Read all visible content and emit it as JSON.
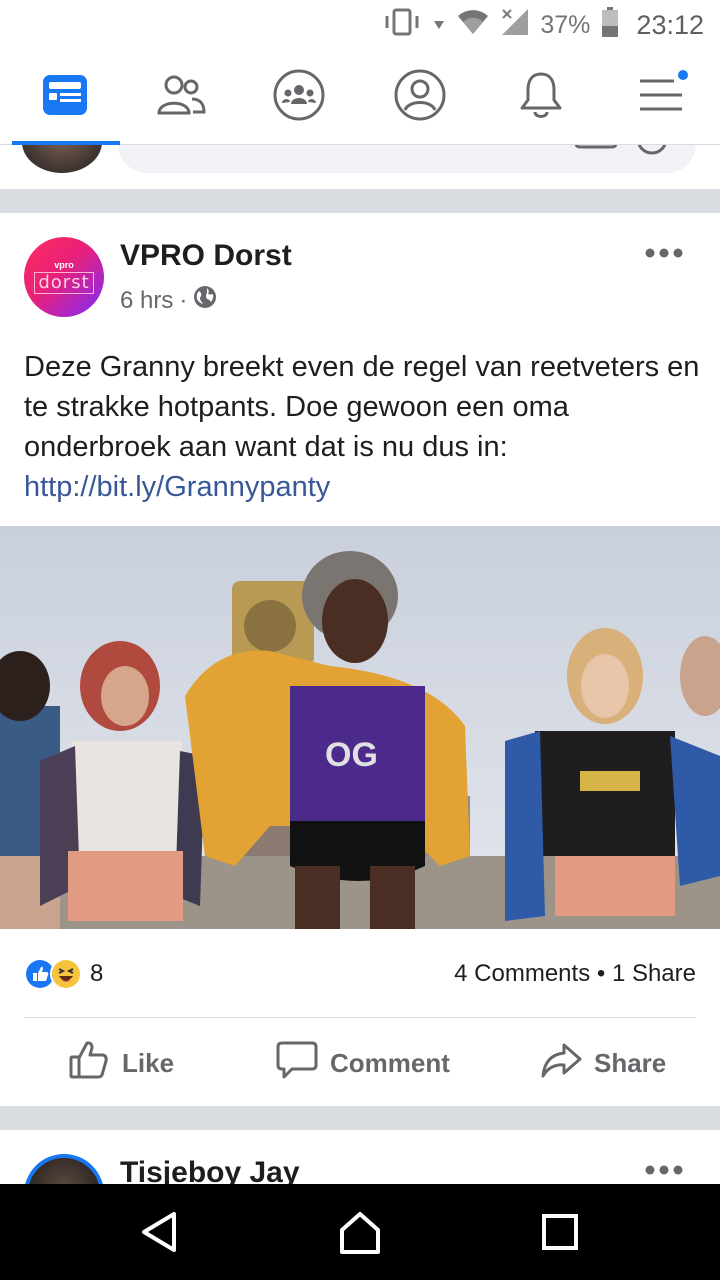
{
  "status_bar": {
    "battery_percent": "37%",
    "time": "23:12"
  },
  "top_nav": {
    "items": [
      {
        "icon": "news-feed-icon",
        "active": true
      },
      {
        "icon": "friends-icon",
        "active": false
      },
      {
        "icon": "groups-icon",
        "active": false
      },
      {
        "icon": "profile-icon",
        "active": false
      },
      {
        "icon": "notifications-icon",
        "active": false
      },
      {
        "icon": "menu-icon",
        "active": false,
        "badge": true
      }
    ],
    "accent_color": "#1877f2"
  },
  "post": {
    "avatar_text_small": "vpro",
    "avatar_text_big": "dorst",
    "author": "VPRO Dorst",
    "time": "6 hrs",
    "meta_separator": "·",
    "privacy_icon": "globe-icon",
    "text": "Deze Granny breekt even de regel van reetveters en te strakke hotpants. Doe gewoon een oma onderbroek aan want dat is nu dus in: ",
    "link": "http://bit.ly/Grannypanty",
    "reaction_icons": [
      "like-reaction-icon",
      "haha-reaction-icon"
    ],
    "reaction_count": "8",
    "comments_shares": "4 Comments • 1 Share",
    "actions": {
      "like": "Like",
      "comment": "Comment",
      "share": "Share"
    }
  },
  "next_post": {
    "author": "Tisjeboy Jay"
  },
  "system_nav": {
    "buttons": [
      "back-icon",
      "home-icon",
      "recents-icon"
    ]
  }
}
